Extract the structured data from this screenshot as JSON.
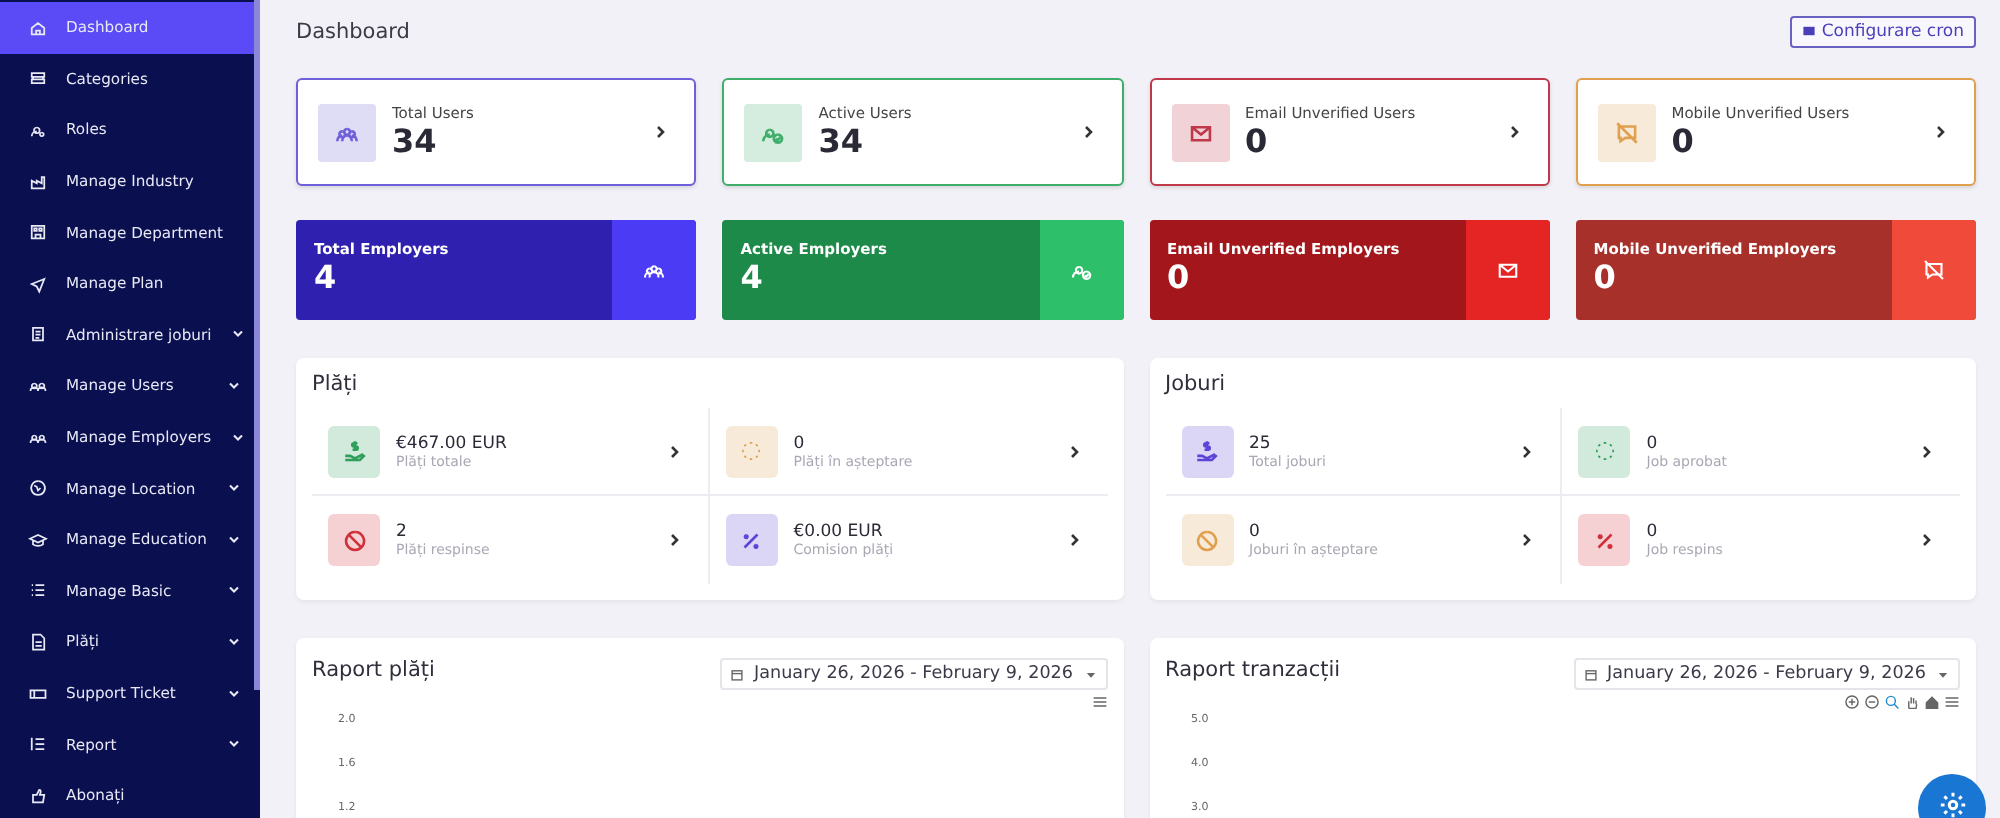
{
  "sidebar": {
    "items": [
      {
        "label": "Dashboard",
        "selected": true,
        "has_submenu": false
      },
      {
        "label": "Categories",
        "selected": false,
        "has_submenu": false
      },
      {
        "label": "Roles",
        "selected": false,
        "has_submenu": false
      },
      {
        "label": "Manage Industry",
        "selected": false,
        "has_submenu": false
      },
      {
        "label": "Manage Department",
        "selected": false,
        "has_submenu": false
      },
      {
        "label": "Manage Plan",
        "selected": false,
        "has_submenu": false
      },
      {
        "label": "Administrare joburi",
        "selected": false,
        "has_submenu": true
      },
      {
        "label": "Manage Users",
        "selected": false,
        "has_submenu": true
      },
      {
        "label": "Manage Employers",
        "selected": false,
        "has_submenu": true
      },
      {
        "label": "Manage Location",
        "selected": false,
        "has_submenu": true
      },
      {
        "label": "Manage Education",
        "selected": false,
        "has_submenu": true
      },
      {
        "label": "Manage Basic",
        "selected": false,
        "has_submenu": true
      },
      {
        "label": "Plăți",
        "selected": false,
        "has_submenu": true
      },
      {
        "label": "Support Ticket",
        "selected": false,
        "has_submenu": true
      },
      {
        "label": "Report",
        "selected": false,
        "has_submenu": true
      },
      {
        "label": "Abonați",
        "selected": false,
        "has_submenu": false
      }
    ]
  },
  "page_title": "Dashboard",
  "cron_button": "Configurare cron",
  "user_cards": [
    {
      "title": "Total Users",
      "value": "34",
      "color": "#6f5fd8",
      "kind": "users"
    },
    {
      "title": "Active Users",
      "value": "34",
      "color": "#3fae6a",
      "kind": "user-check"
    },
    {
      "title": "Email Unverified Users",
      "value": "0",
      "color": "#c0394a",
      "kind": "mail"
    },
    {
      "title": "Mobile Unverified Users",
      "value": "0",
      "color": "#e0a050",
      "kind": "message-off"
    }
  ],
  "employer_cards": [
    {
      "title": "Total Employers",
      "value": "4",
      "color": "#2f20b0",
      "accent": {
        "color": "#4b3bf5"
      },
      "kind": "users"
    },
    {
      "title": "Active Employers",
      "value": "4",
      "color": "#1e8a4a",
      "accent": {
        "color": "#2dbf6a"
      },
      "kind": "user-check"
    },
    {
      "title": "Email Unverified Employers",
      "value": "0",
      "color": "#a3161b",
      "accent": {
        "color": "#e52424"
      },
      "kind": "mail"
    },
    {
      "title": "Mobile Unverified Employers",
      "value": "0",
      "color": "#a8302a",
      "accent": {
        "color": "#ef4a3a"
      },
      "kind": "message-off"
    }
  ],
  "panels": [
    {
      "title": "Plăți",
      "items": [
        {
          "value": "€467.00 EUR",
          "label": "Plăți totale",
          "color": "#2e9e5a",
          "kind": "hand-coin"
        },
        {
          "value": "0",
          "label": "Plăți în așteptare",
          "color": "#e0a050",
          "kind": "spinner"
        },
        {
          "value": "2",
          "label": "Plăți respinse",
          "color": "#d0303a",
          "kind": "ban"
        },
        {
          "value": "€0.00 EUR",
          "label": "Comision plăți",
          "color": "#5b45d8",
          "kind": "percent"
        }
      ]
    },
    {
      "title": "Joburi",
      "items": [
        {
          "value": "25",
          "label": "Total joburi",
          "color": "#5b45d8",
          "kind": "hand-coin"
        },
        {
          "value": "0",
          "label": "Job aprobat",
          "color": "#2e9e5a",
          "kind": "spinner"
        },
        {
          "value": "0",
          "label": "Joburi în așteptare",
          "color": "#e0a050",
          "kind": "ban"
        },
        {
          "value": "0",
          "label": "Job respins",
          "color": "#d0303a",
          "kind": "percent"
        }
      ]
    }
  ],
  "reports": [
    {
      "title": "Raport plăți",
      "date_range": "January 26, 2026 - February 9, 2026",
      "zoom_tools": false,
      "yticks": [
        "2.0",
        "1.6",
        "1.2"
      ]
    },
    {
      "title": "Raport tranzacții",
      "date_range": "January 26, 2026 - February 9, 2026",
      "zoom_tools": true,
      "yticks": [
        "5.0",
        "4.0",
        "3.0"
      ]
    }
  ]
}
